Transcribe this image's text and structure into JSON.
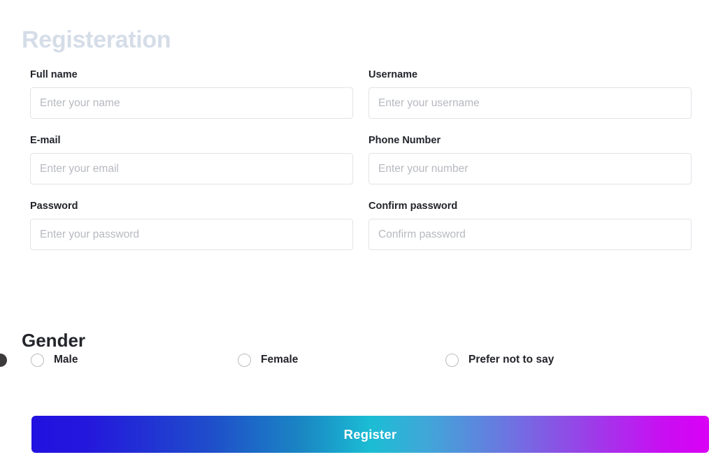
{
  "page": {
    "title": "Registeration"
  },
  "form": {
    "rows": [
      [
        {
          "label": "Full name",
          "placeholder": "Enter your name",
          "value": "",
          "name": "full-name"
        },
        {
          "label": "Username",
          "placeholder": "Enter your username",
          "value": "",
          "name": "username"
        }
      ],
      [
        {
          "label": "E-mail",
          "placeholder": "Enter your email",
          "value": "",
          "name": "email"
        },
        {
          "label": "Phone Number",
          "placeholder": "Enter your number",
          "value": "",
          "name": "phone-number"
        }
      ],
      [
        {
          "label": "Password",
          "placeholder": "Enter your password",
          "value": "",
          "name": "password"
        },
        {
          "label": "Confirm password",
          "placeholder": "Confirm password",
          "value": "",
          "name": "confirm-password"
        }
      ]
    ]
  },
  "gender": {
    "heading": "Gender",
    "options": [
      {
        "label": "Male",
        "selected": false
      },
      {
        "label": "Female",
        "selected": false
      },
      {
        "label": "Prefer not to say",
        "selected": false
      }
    ]
  },
  "submit": {
    "label": "Register"
  },
  "colors": {
    "title": "#d5dde8",
    "label_text": "#22242a",
    "placeholder": "#b6b9bf",
    "input_border": "#e1e3e7",
    "radio_border": "#b9bcc2",
    "button_gradient_start": "#2211e0",
    "button_gradient_mid": "#1bbdd4",
    "button_gradient_end": "#d900f5",
    "button_text": "#ffffff",
    "background": "#ffffff"
  }
}
